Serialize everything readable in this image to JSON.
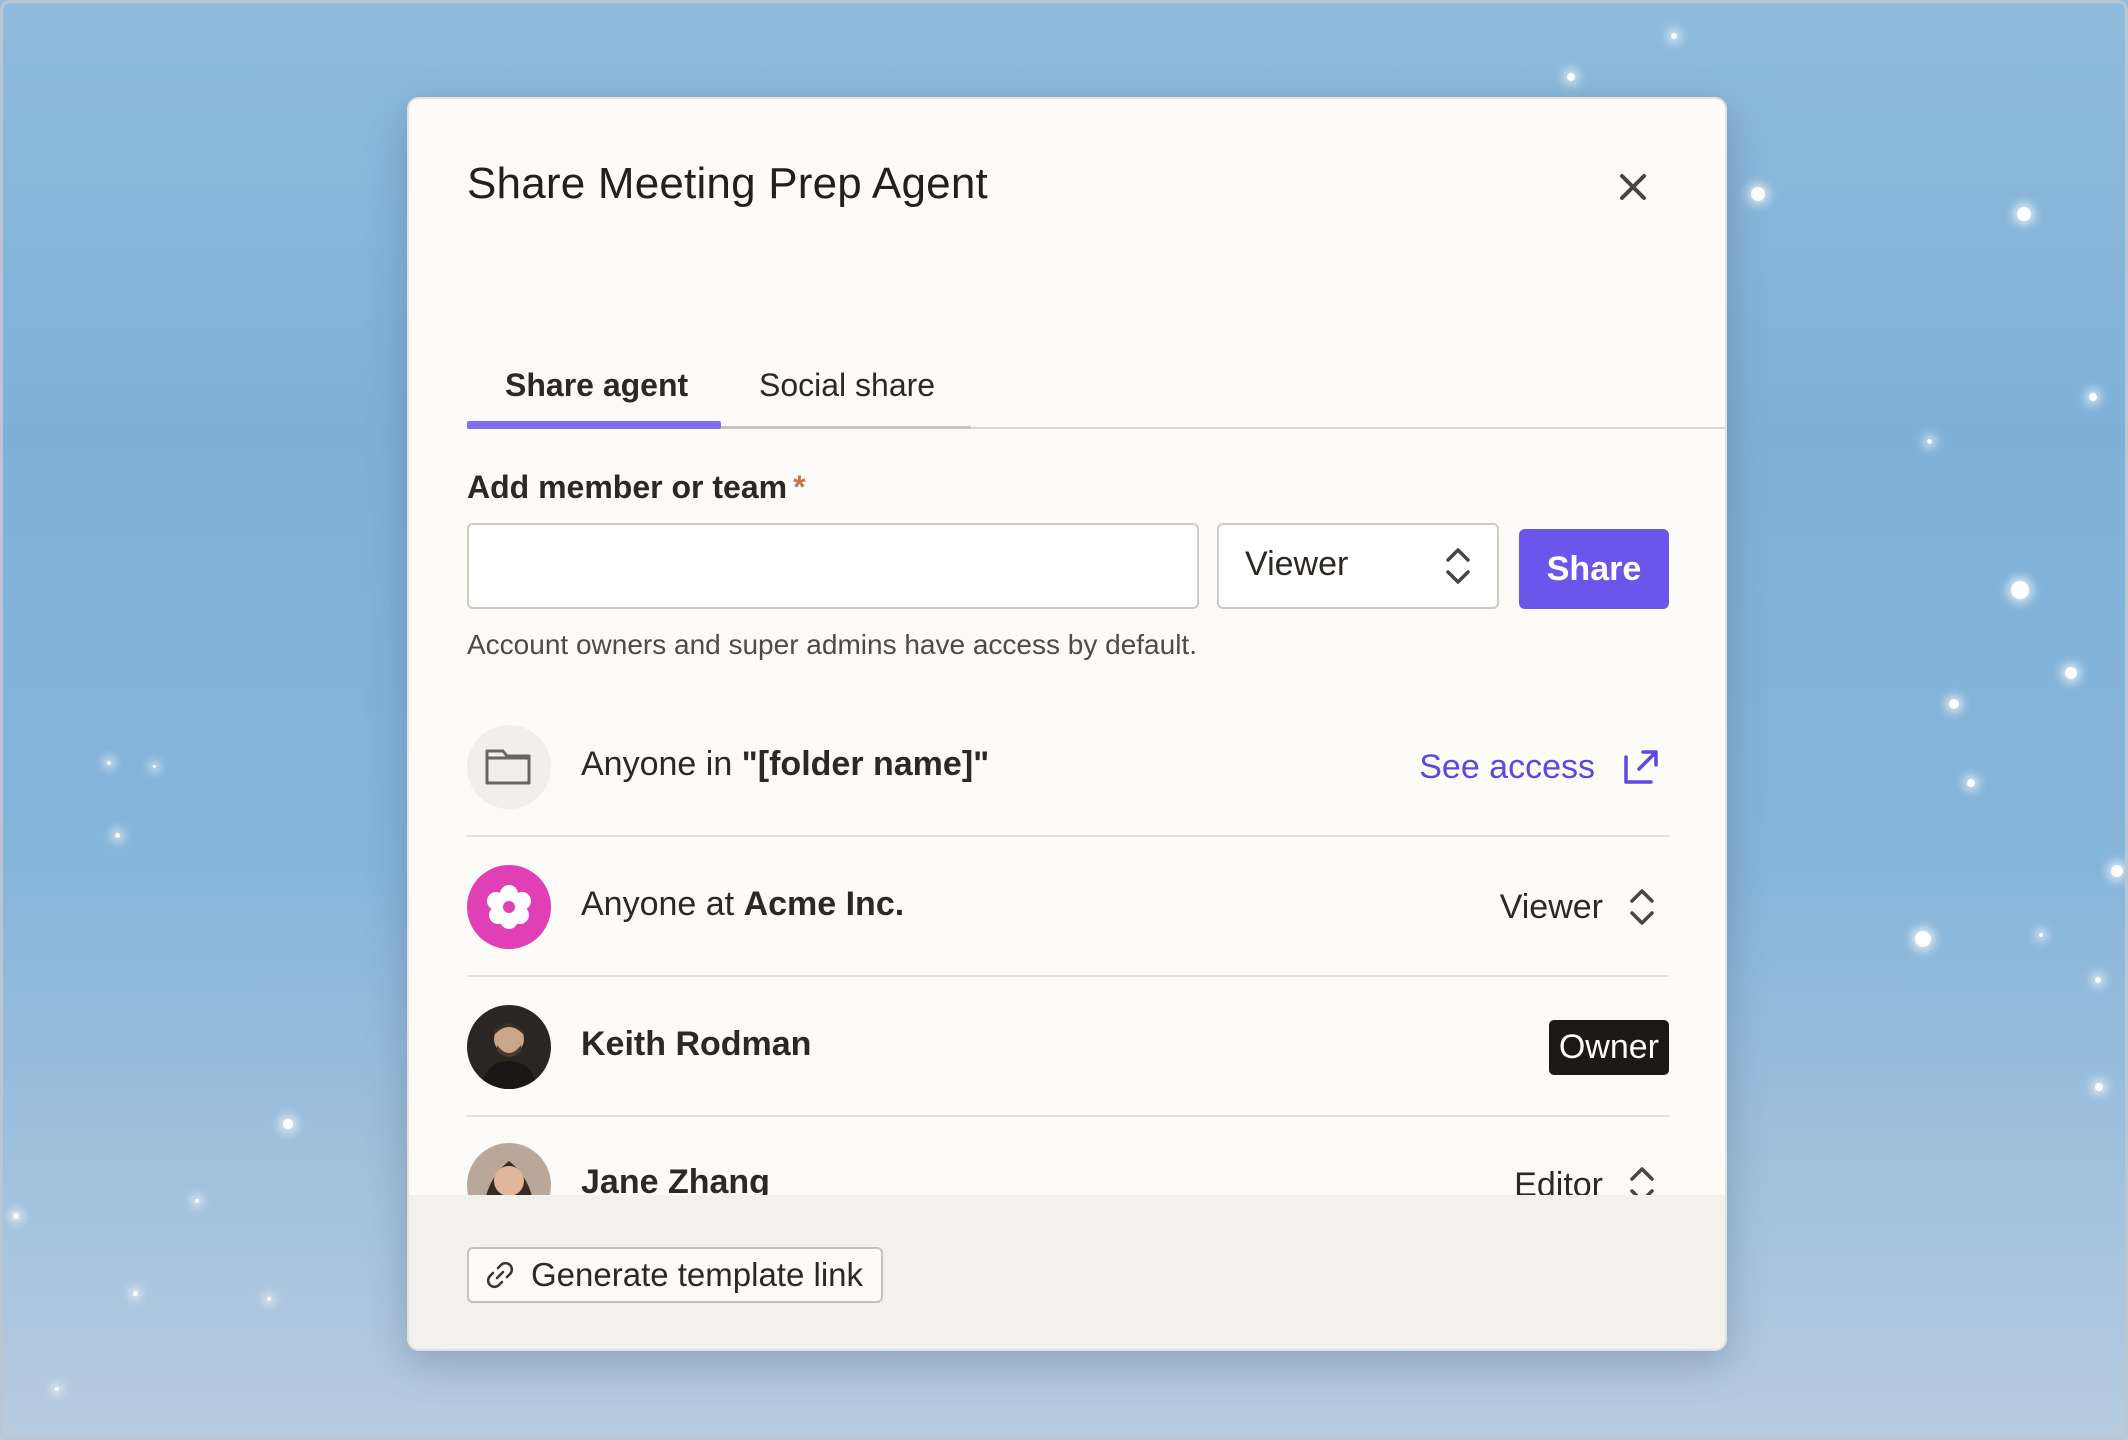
{
  "dialog": {
    "title": "Share Meeting Prep Agent",
    "close_icon": "close-icon"
  },
  "tabs": [
    {
      "label": "Share agent",
      "active": true
    },
    {
      "label": "Social share",
      "active": false
    }
  ],
  "add_member": {
    "label": "Add member or team",
    "required_mark": "*",
    "input_value": "",
    "input_placeholder": "",
    "role": "Viewer",
    "share_button": "Share",
    "helper_text": "Account owners and super admins have access by default."
  },
  "access_list": [
    {
      "kind": "folder",
      "icon": "folder-icon",
      "prefix": "Anyone in ",
      "emphasis": "\"[folder name]\"",
      "suffix": "",
      "action": "See access",
      "action_icon": "external-link-icon"
    },
    {
      "kind": "org",
      "icon": "flower-logo-icon",
      "prefix": "Anyone at ",
      "emphasis": "Acme Inc.",
      "role": "Viewer"
    },
    {
      "kind": "user",
      "name": "Keith Rodman",
      "role": "Owner"
    },
    {
      "kind": "user",
      "name": "Jane Zhang",
      "role": "Editor"
    }
  ],
  "footer": {
    "generate_link": "Generate template link",
    "link_icon": "link-icon"
  },
  "colors": {
    "accent": "#6b55eb",
    "tab_underline": "#7f6ef1",
    "link": "#5b49e0",
    "org_logo": "#e13fb5",
    "owner_badge": "#1c1917"
  }
}
